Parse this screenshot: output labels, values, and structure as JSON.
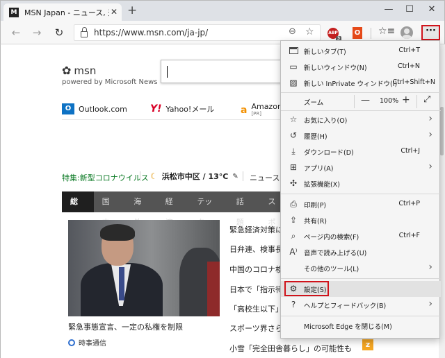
{
  "window": {
    "tab_title": "MSN Japan - ニュース, 天気, メール (",
    "tab_favicon": "msn-favicon",
    "new_tab_glyph": "+",
    "close_tab_glyph": "✕",
    "minimize_glyph": "—",
    "maximize_glyph": "☐",
    "close_window_glyph": "✕"
  },
  "toolbar": {
    "back_glyph": "←",
    "forward_glyph": "→",
    "refresh_glyph": "↻",
    "url": "https://www.msn.com/ja-jp/",
    "zoom_glyph": "⊖",
    "favorite_glyph": "☆",
    "ext1_label": "ABP",
    "ext1_badge": "3",
    "ext2_label": "O",
    "favorites_glyph": "☆≡",
    "more_glyph": "···"
  },
  "page": {
    "logo_text": "msn",
    "powered_by": "powered by Microsoft News",
    "quicklinks": [
      {
        "label": "Outlook.com",
        "icon": "outlook-icon"
      },
      {
        "label": "Yahoo!メール",
        "icon": "yahoo-icon"
      },
      {
        "label": "Amazon",
        "sub": "[PR]",
        "icon": "amazon-icon"
      }
    ],
    "covid_label": "特集:新型コロナウイルス",
    "weather_city": "浜松市中区 / 13°C",
    "weather_pen": "✎",
    "news_link": "ニュース",
    "nav_tabs": [
      "総合",
      "国内",
      "海外",
      "経済",
      "テック",
      "話題",
      "スポ"
    ],
    "nav_active": "総合",
    "main_caption": "緊急事態宣言、一定の私権を制限",
    "main_source": "時事通信",
    "headlines": [
      "緊急経済対策に",
      "日弁連、検事長定",
      "中国のコロナ検査",
      "日本で「指示待ち",
      "「高校生以下」等",
      "スポーツ界さらに"
    ],
    "last_headline": "小雪「完全田舎暮らし」の可能性も"
  },
  "menu": {
    "items": [
      {
        "icon": "new-tab-icon",
        "label": "新しいタブ(T)",
        "shortcut": "Ctrl+T"
      },
      {
        "icon": "new-window-icon",
        "label": "新しいウィンドウ(N)",
        "shortcut": "Ctrl+N"
      },
      {
        "icon": "inprivate-icon",
        "label": "新しい InPrivate ウィンドウ(I)",
        "shortcut": "Ctrl+Shift+N"
      },
      {
        "icon": "",
        "label": "ズーム",
        "shortcut": ""
      },
      {
        "icon": "favorites-icon",
        "label": "お気に入り(O)",
        "shortcut": ""
      },
      {
        "icon": "history-icon",
        "label": "履歴(H)",
        "shortcut": ""
      },
      {
        "icon": "download-icon",
        "label": "ダウンロード(D)",
        "shortcut": "Ctrl+J"
      },
      {
        "icon": "apps-icon",
        "label": "アプリ(A)",
        "shortcut": ""
      },
      {
        "icon": "extensions-icon",
        "label": "拡張機能(X)",
        "shortcut": ""
      },
      {
        "icon": "print-icon",
        "label": "印刷(P)",
        "shortcut": "Ctrl+P"
      },
      {
        "icon": "share-icon",
        "label": "共有(R)",
        "shortcut": ""
      },
      {
        "icon": "find-icon",
        "label": "ページ内の検索(F)",
        "shortcut": "Ctrl+F"
      },
      {
        "icon": "read-aloud-icon",
        "label": "音声で読み上げる(U)",
        "shortcut": ""
      },
      {
        "icon": "",
        "label": "その他のツール(L)",
        "shortcut": ""
      },
      {
        "icon": "settings-icon",
        "label": "設定(S)",
        "shortcut": ""
      },
      {
        "icon": "help-icon",
        "label": "ヘルプとフィードバック(B)",
        "shortcut": ""
      },
      {
        "icon": "",
        "label": "Microsoft Edge を閉じる(M)",
        "shortcut": ""
      }
    ],
    "zoom_minus": "—",
    "zoom_value": "100%",
    "zoom_plus": "+",
    "zoom_fullscreen": "⤢",
    "submenu_arrow": "›"
  },
  "colors": {
    "highlight_red": "#d0131b",
    "covid_green": "#0b7a24",
    "nav_bg": "#545454"
  }
}
